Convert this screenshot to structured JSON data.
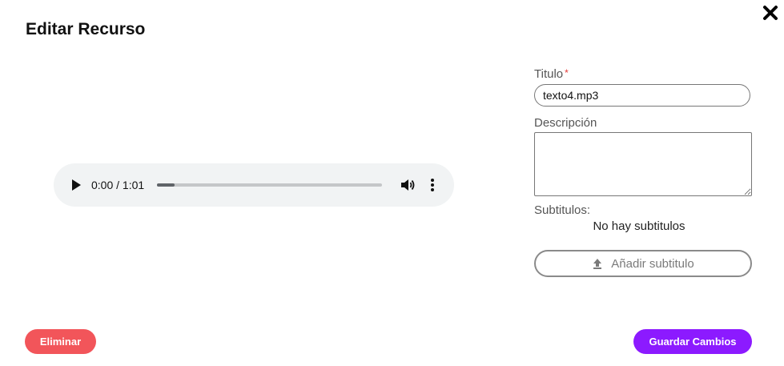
{
  "dialog": {
    "title": "Editar Recurso"
  },
  "player": {
    "time": "0:00 / 1:01",
    "progress_fraction": 0.08
  },
  "form": {
    "title_label": "Titulo",
    "title_required_mark": "*",
    "title_value": "texto4.mp3",
    "description_label": "Descripción",
    "description_value": "",
    "subtitles_label": "Subtitulos:",
    "no_subtitles_text": "No hay subtitulos",
    "add_subtitle_label": "Añadir subtitulo"
  },
  "actions": {
    "delete_label": "Eliminar",
    "save_label": "Guardar Cambios"
  },
  "colors": {
    "delete": "#f2555a",
    "save": "#8c1aff"
  },
  "icons": {
    "close": "close-icon",
    "play": "play-icon",
    "volume": "volume-icon",
    "more": "more-vertical-icon",
    "upload": "upload-icon"
  }
}
